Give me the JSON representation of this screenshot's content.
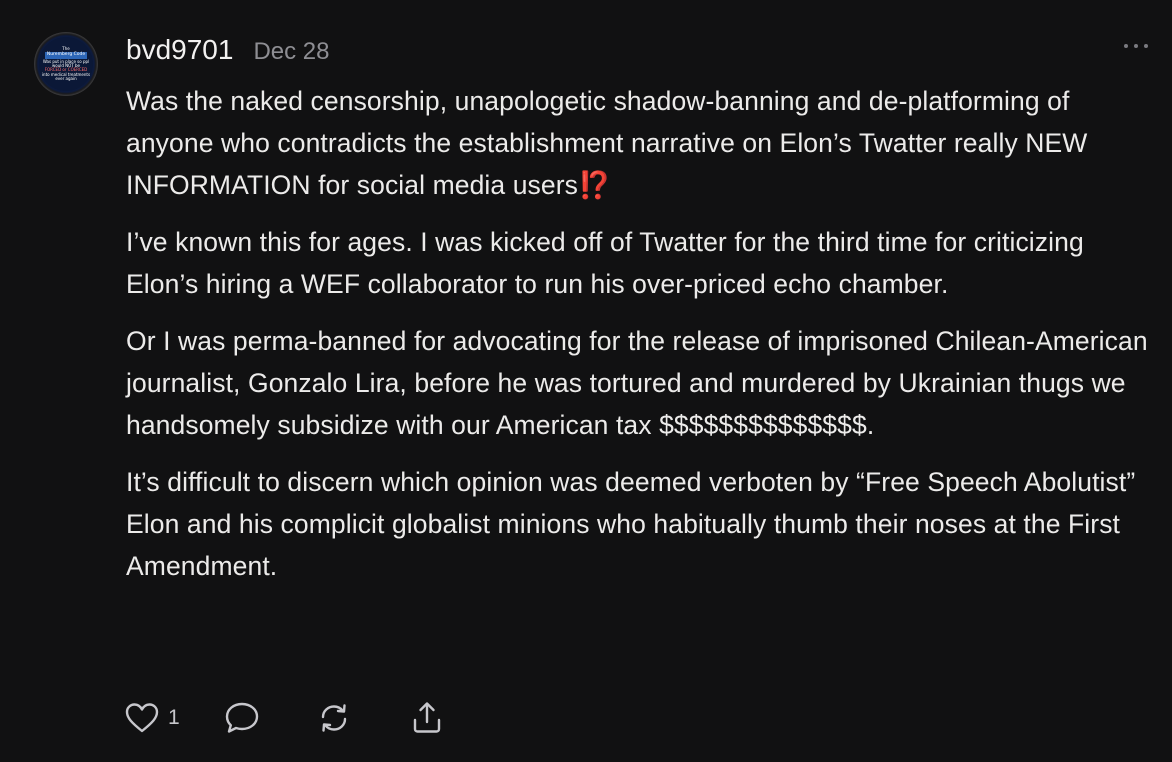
{
  "comment": {
    "avatar": {
      "icon": "nuremberg-code-avatar",
      "lines": [
        "The",
        "Nuremberg Code",
        "Was put in place so ppl",
        "would NOT be",
        "FORCED or COERCED",
        "into medical treatments",
        "ever again"
      ]
    },
    "username": "bvd9701",
    "date": "Dec 28",
    "more_icon": "ellipsis-icon",
    "paragraphs": [
      "Was the naked censorship, unapologetic shadow-banning and de-platforming of anyone who contradicts the establishment narrative on Elon’s Twatter really NEW INFORMATION for social media users",
      "I’ve known this for ages. I was kicked off of Twatter for the third time for criticizing Elon’s hiring a WEF collaborator to run his over-priced echo chamber.",
      "Or I was perma-banned for advocating for the release of imprisoned Chilean-American journalist, Gonzalo Lira, before he was tortured and murdered by Ukrainian thugs we handsomely subsidize with our American tax $$$$$$$$$$$$$$.",
      "It’s difficult to discern which opinion was deemed verboten by “Free Speech Abolutist” Elon and his complicit globalist minions who habitually thumb their noses at the First Amendment."
    ],
    "emoji": "⁉️",
    "actions": {
      "like_icon": "heart-icon",
      "like_count": "1",
      "reply_icon": "speech-bubble-icon",
      "restack_icon": "restack-icon",
      "share_icon": "share-icon"
    }
  },
  "colors": {
    "background": "#111112",
    "text": "#ecebea",
    "muted": "#8e8e93",
    "accent_emoji": "#e8442e"
  }
}
